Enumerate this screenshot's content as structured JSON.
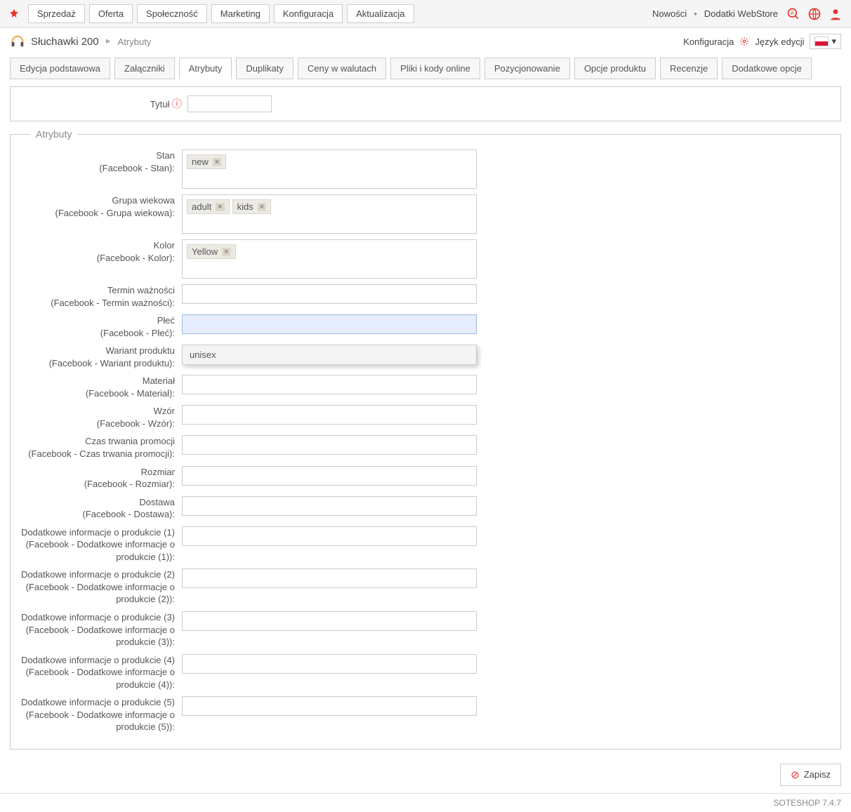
{
  "topbar": {
    "menu": [
      "Sprzedaż",
      "Oferta",
      "Społeczność",
      "Marketing",
      "Konfiguracja",
      "Aktualizacja"
    ],
    "links": {
      "news": "Nowości",
      "webstore": "Dodatki WebStore"
    }
  },
  "breadcrumb": {
    "title": "Słuchawki 200",
    "sub": "Atrybuty",
    "config": "Konfiguracja",
    "lang": "Język edycji"
  },
  "tabs": [
    "Edycja podstawowa",
    "Załączniki",
    "Atrybuty",
    "Duplikaty",
    "Ceny w walutach",
    "Pliki i kody online",
    "Pozycjonowanie",
    "Opcje produktu",
    "Recenzje",
    "Dodatkowe opcje"
  ],
  "title_section": {
    "label": "Tytuł"
  },
  "legend": "Atrybuty",
  "attributes": [
    {
      "label": "Stan",
      "sub": "(Facebook - Stan):",
      "type": "tags",
      "tags": [
        "new"
      ]
    },
    {
      "label": "Grupa wiekowa",
      "sub": "(Facebook - Grupa wiekowa):",
      "type": "tags",
      "tags": [
        "adult",
        "kids"
      ]
    },
    {
      "label": "Kolor",
      "sub": "(Facebook - Kolor):",
      "type": "tags",
      "tags": [
        "Yellow"
      ]
    },
    {
      "label": "Termin ważności",
      "sub": "(Facebook - Termin ważności):",
      "type": "text"
    },
    {
      "label": "Płeć",
      "sub": "(Facebook - Płeć):",
      "type": "plec"
    },
    {
      "label": "Wariant produktu",
      "sub": "(Facebook - Wariant produktu):",
      "type": "dropdown_target"
    },
    {
      "label": "Materiał",
      "sub": "(Facebook - Materiał):",
      "type": "text"
    },
    {
      "label": "Wzór",
      "sub": "(Facebook - Wzór):",
      "type": "text"
    },
    {
      "label": "Czas trwania promocji",
      "sub": "(Facebook - Czas trwania promocji):",
      "type": "text"
    },
    {
      "label": "Rozmiar",
      "sub": "(Facebook - Rozmiar):",
      "type": "text"
    },
    {
      "label": "Dostawa",
      "sub": "(Facebook - Dostawa):",
      "type": "text"
    },
    {
      "label": "Dodatkowe informacje o produkcie (1)",
      "sub": "(Facebook - Dodatkowe informacje o produkcie (1)):",
      "type": "text"
    },
    {
      "label": "Dodatkowe informacje o produkcie (2)",
      "sub": "(Facebook - Dodatkowe informacje o produkcie (2)):",
      "type": "text"
    },
    {
      "label": "Dodatkowe informacje o produkcie (3)",
      "sub": "(Facebook - Dodatkowe informacje o produkcie (3)):",
      "type": "text"
    },
    {
      "label": "Dodatkowe informacje o produkcie (4)",
      "sub": "(Facebook - Dodatkowe informacje o produkcie (4)):",
      "type": "text"
    },
    {
      "label": "Dodatkowe informacje o produkcie (5)",
      "sub": "(Facebook - Dodatkowe informacje o produkcie (5)):",
      "type": "text"
    }
  ],
  "dropdown_option": "unisex",
  "save_label": "Zapisz",
  "version": "SOTESHOP 7.4.7"
}
